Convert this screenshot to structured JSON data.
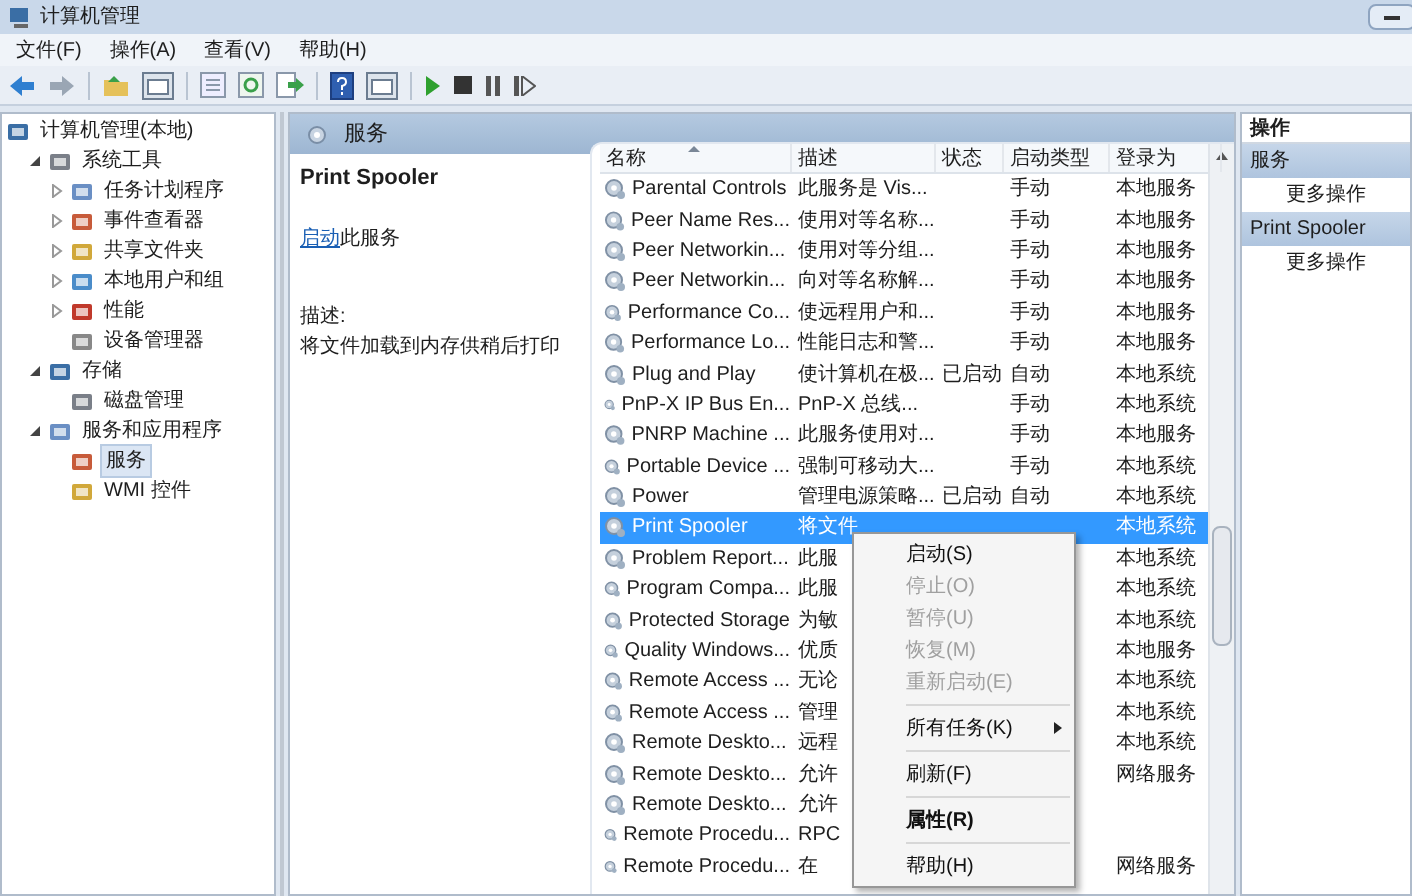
{
  "window": {
    "title": "计算机管理"
  },
  "menu": [
    "文件(F)",
    "操作(A)",
    "查看(V)",
    "帮助(H)"
  ],
  "tree": [
    {
      "label": "计算机管理(本地)",
      "selected": false,
      "children": [
        {
          "label": "系统工具",
          "expanded": true,
          "selected": false,
          "children": [
            {
              "label": "任务计划程序",
              "expanded": false,
              "selected": false
            },
            {
              "label": "事件查看器",
              "expanded": false,
              "selected": false
            },
            {
              "label": "共享文件夹",
              "expanded": false,
              "selected": false
            },
            {
              "label": "本地用户和组",
              "expanded": false,
              "selected": false
            },
            {
              "label": "性能",
              "expanded": false,
              "selected": false
            },
            {
              "label": "设备管理器",
              "selected": false
            }
          ]
        },
        {
          "label": "存储",
          "expanded": true,
          "selected": false,
          "children": [
            {
              "label": "磁盘管理",
              "selected": false
            }
          ]
        },
        {
          "label": "服务和应用程序",
          "expanded": true,
          "selected": false,
          "children": [
            {
              "label": "服务",
              "selected": true
            },
            {
              "label": "WMI 控件",
              "selected": false
            }
          ]
        }
      ]
    }
  ],
  "pane_header": "服务",
  "detail": {
    "title": "Print Spooler",
    "link": "启动",
    "link_rest": "此服务",
    "description_label": "描述:",
    "description": "将文件加载到内存供稍后打印"
  },
  "table": {
    "columns": [
      "名称",
      "描述",
      "状态",
      "启动类型",
      "登录为"
    ],
    "rows": [
      {
        "name": "Parental Controls",
        "description": "此服务是 Vis...",
        "startup": "手动",
        "login": "本地服务",
        "selected": false
      },
      {
        "name": "Peer Name Res...",
        "description": "使用对等名称...",
        "startup": "手动",
        "login": "本地服务",
        "selected": false
      },
      {
        "name": "Peer Networkin...",
        "description": "使用对等分组...",
        "startup": "手动",
        "login": "本地服务",
        "selected": false
      },
      {
        "name": "Peer Networkin...",
        "description": "向对等名称解...",
        "startup": "手动",
        "login": "本地服务",
        "selected": false
      },
      {
        "name": "Performance Co...",
        "description": "使远程用户和...",
        "startup": "手动",
        "login": "本地服务",
        "selected": false
      },
      {
        "name": "Performance Lo...",
        "description": "性能日志和警...",
        "startup": "手动",
        "login": "本地服务",
        "selected": false
      },
      {
        "name": "Plug and Play",
        "description": "使计算机在极...",
        "status": "已启动",
        "startup": "自动",
        "login": "本地系统",
        "selected": false
      },
      {
        "name": "PnP-X IP Bus En...",
        "description": "PnP-X 总线...",
        "startup": "手动",
        "login": "本地系统",
        "selected": false
      },
      {
        "name": "PNRP Machine ...",
        "description": "此服务使用对...",
        "startup": "手动",
        "login": "本地服务",
        "selected": false
      },
      {
        "name": "Portable Device ...",
        "description": "强制可移动大...",
        "startup": "手动",
        "login": "本地系统",
        "selected": false
      },
      {
        "name": "Power",
        "description": "管理电源策略...",
        "status": "已启动",
        "startup": "自动",
        "login": "本地系统",
        "selected": false
      },
      {
        "name": "Print Spooler",
        "description": "将文件",
        "login": "本地系统",
        "selected": true
      },
      {
        "name": "Problem Report...",
        "description": "此服",
        "login": "本地系统",
        "selected": false
      },
      {
        "name": "Program Compa...",
        "description": "此服",
        "login": "本地系统",
        "selected": false
      },
      {
        "name": "Protected Storage",
        "description": "为敏",
        "login": "本地系统",
        "selected": false
      },
      {
        "name": "Quality Windows...",
        "description": "优质",
        "login": "本地服务",
        "selected": false
      },
      {
        "name": "Remote Access ...",
        "description": "无论",
        "login": "本地系统",
        "selected": false
      },
      {
        "name": "Remote Access ...",
        "description": "管理",
        "login": "本地系统",
        "selected": false
      },
      {
        "name": "Remote Deskto...",
        "description": "远程",
        "login": "本地系统",
        "selected": false
      },
      {
        "name": "Remote Deskto...",
        "description": "允许",
        "login": "网络服务",
        "selected": false
      },
      {
        "name": "Remote Deskto...",
        "description": "允许",
        "selected": false
      },
      {
        "name": "Remote Procedu...",
        "description": "RPC",
        "selected": false
      },
      {
        "name": "Remote Procedu...",
        "description": "在",
        "login": "网络服务",
        "selected": false
      }
    ]
  },
  "context_menu": [
    {
      "label": "启动(S)",
      "disabled": false
    },
    {
      "label": "停止(O)",
      "disabled": true
    },
    {
      "label": "暂停(U)",
      "disabled": true
    },
    {
      "label": "恢复(M)",
      "disabled": true
    },
    {
      "label": "重新启动(E)",
      "disabled": true
    },
    {
      "label": "所有任务(K)",
      "disabled": false,
      "separator_before": true,
      "submenu": true
    },
    {
      "label": "刷新(F)",
      "disabled": false,
      "separator_before": true
    },
    {
      "label": "属性(R)",
      "disabled": false,
      "separator_before": true,
      "default": true
    },
    {
      "label": "帮助(H)",
      "disabled": false,
      "separator_before": true
    }
  ],
  "actions": {
    "title": "操作",
    "sections": [
      {
        "title": "服务",
        "items": [
          "更多操作"
        ]
      },
      {
        "title": "Print Spooler",
        "items": [
          "更多操作"
        ]
      }
    ]
  }
}
